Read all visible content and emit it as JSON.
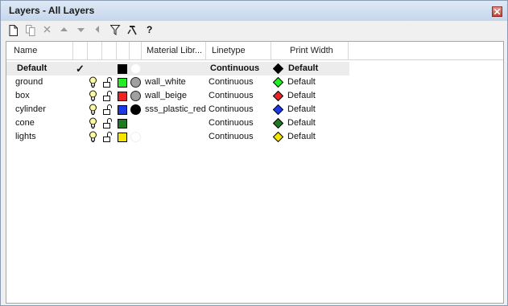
{
  "window": {
    "title": "Layers - All Layers"
  },
  "toolbar": {
    "buttons": [
      {
        "name": "new-layer-button",
        "icon": "new-document-icon"
      },
      {
        "name": "new-sublayer-button",
        "icon": "copy-icon"
      },
      {
        "name": "delete-button",
        "icon": "delete-x-icon"
      },
      {
        "name": "move-up-button",
        "icon": "triangle-up-icon"
      },
      {
        "name": "move-down-button",
        "icon": "triangle-down-icon"
      },
      {
        "name": "move-parent-button",
        "icon": "triangle-left-icon"
      },
      {
        "name": "filter-button",
        "icon": "funnel-icon"
      },
      {
        "name": "tools-button",
        "icon": "hammer-icon"
      },
      {
        "name": "help-button",
        "label": "?"
      }
    ]
  },
  "columns": [
    "Name",
    "Material Libr...",
    "Linetype",
    "Print Width"
  ],
  "rows": [
    {
      "name": "Default",
      "current": true,
      "check": "✓",
      "visible": false,
      "color": "#000000",
      "material_swatch": "",
      "material": "",
      "linetype": "Continuous",
      "print_color": "#000000",
      "print_width": "Default"
    },
    {
      "name": "ground",
      "current": false,
      "check": "",
      "visible": true,
      "color": "#22ee22",
      "material_swatch": "#a0a0a0",
      "material": "wall_white",
      "linetype": "Continuous",
      "print_color": "#22ee22",
      "print_width": "Default"
    },
    {
      "name": "box",
      "current": false,
      "check": "",
      "visible": true,
      "color": "#ee2222",
      "material_swatch": "#a0a0a0",
      "material": "wall_beige",
      "linetype": "Continuous",
      "print_color": "#ee2222",
      "print_width": "Default"
    },
    {
      "name": "cylinder",
      "current": false,
      "check": "",
      "visible": true,
      "color": "#1a3ae8",
      "material_swatch": "#000000",
      "material": "sss_plastic_red",
      "linetype": "Continuous",
      "print_color": "#1a3ae8",
      "print_width": "Default"
    },
    {
      "name": "cone",
      "current": false,
      "check": "",
      "visible": true,
      "color": "#1f7a1f",
      "material_swatch": "",
      "material": "",
      "linetype": "Continuous",
      "print_color": "#1f7a1f",
      "print_width": "Default"
    },
    {
      "name": "lights",
      "current": false,
      "check": "",
      "visible": true,
      "color": "#f5e500",
      "material_swatch": "",
      "material": "",
      "linetype": "Continuous",
      "print_color": "#f5e500",
      "print_width": "Default"
    }
  ]
}
